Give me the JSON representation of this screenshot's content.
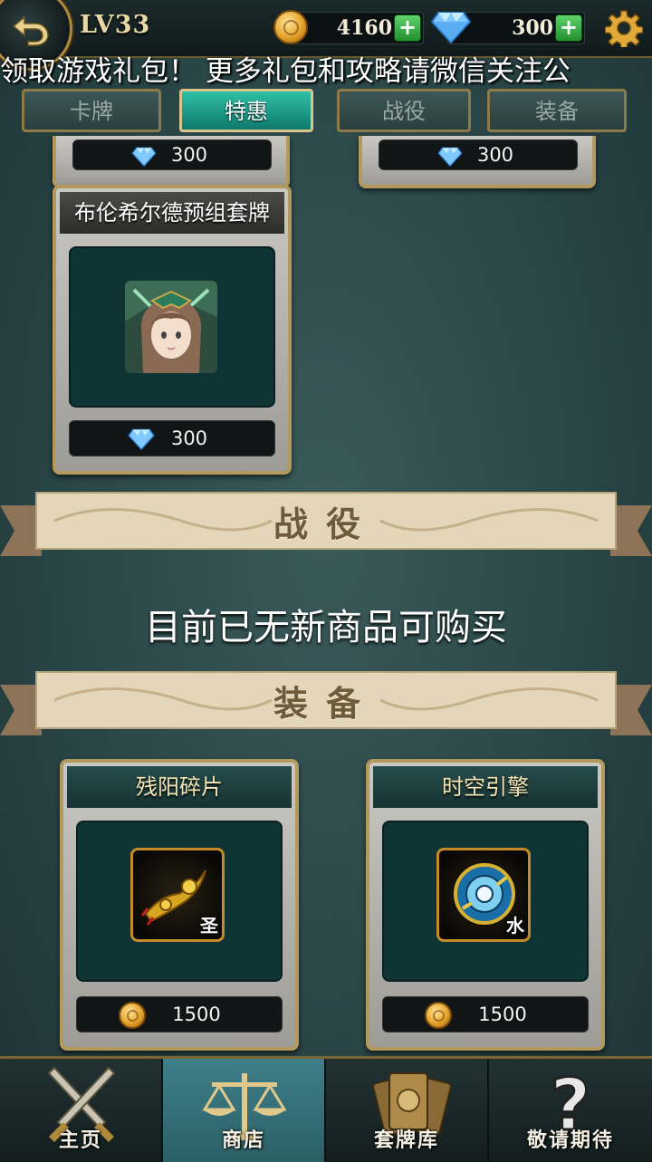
{
  "header": {
    "level": "LV33",
    "gold": "4160",
    "gems": "300",
    "plus_symbol": "+"
  },
  "marquee": "领取游戏礼包！ 更多礼包和攻略请微信关注公",
  "tabs": [
    {
      "label": "卡牌",
      "active": false
    },
    {
      "label": "特惠",
      "active": true
    },
    {
      "label": "战役",
      "active": false
    },
    {
      "label": "装备",
      "active": false
    }
  ],
  "partial_cards": [
    {
      "price": "300",
      "currency": "gem"
    },
    {
      "price": "300",
      "currency": "gem"
    }
  ],
  "deck_card": {
    "title": "布伦希尔德预组套牌",
    "price": "300",
    "currency": "gem"
  },
  "sections": {
    "campaign": {
      "title": "战役",
      "empty_message": "目前已无新商品可购买"
    },
    "equipment": {
      "title": "装备"
    }
  },
  "equipment_items": [
    {
      "title": "残阳碎片",
      "element": "圣",
      "price": "1500",
      "currency": "coin"
    },
    {
      "title": "时空引擎",
      "element": "水",
      "price": "1500",
      "currency": "coin"
    }
  ],
  "bottom_nav": [
    {
      "label": "主页",
      "icon": "crossed-swords-icon",
      "active": false
    },
    {
      "label": "商店",
      "icon": "scales-icon",
      "active": true
    },
    {
      "label": "套牌库",
      "icon": "cards-icon",
      "active": false
    },
    {
      "label": "敬请期待",
      "icon": "question-mark-icon",
      "active": false
    }
  ],
  "colors": {
    "accent": "#2fc0a8",
    "gold_trim": "#b39a5c",
    "panel": "#0f3434"
  }
}
